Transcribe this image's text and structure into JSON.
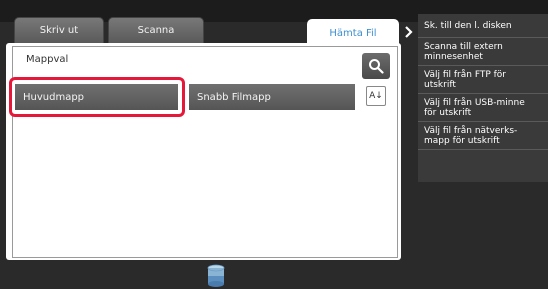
{
  "tabs": [
    {
      "label": "Skriv ut"
    },
    {
      "label": "Scanna"
    },
    {
      "label": "Hämta Fil"
    }
  ],
  "folder_panel": {
    "title": "Mappval",
    "buttons": [
      {
        "label": "Huvudmapp",
        "highlighted": true
      },
      {
        "label": "Snabb Filmapp"
      }
    ],
    "sort_label": "A↓"
  },
  "side_menu": {
    "items": [
      {
        "label_lines": [
          "Sk. till den l. disken"
        ]
      },
      {
        "label_lines": [
          "Scanna till extern",
          "minnesenhet"
        ]
      },
      {
        "label_lines": [
          "Välj fil från FTP för",
          "utskrift"
        ]
      },
      {
        "label_lines": [
          "Välj fil från USB-minne",
          "för utskrift"
        ]
      },
      {
        "label_lines": [
          "Välj fil från nätverks-",
          "mapp för utskrift"
        ]
      }
    ]
  },
  "colors": {
    "highlight": "#e5183a",
    "active_tab_text": "#3e8fd0"
  },
  "icons": [
    "search-icon",
    "sort-icon",
    "chevron-right-icon",
    "storage-icon"
  ]
}
